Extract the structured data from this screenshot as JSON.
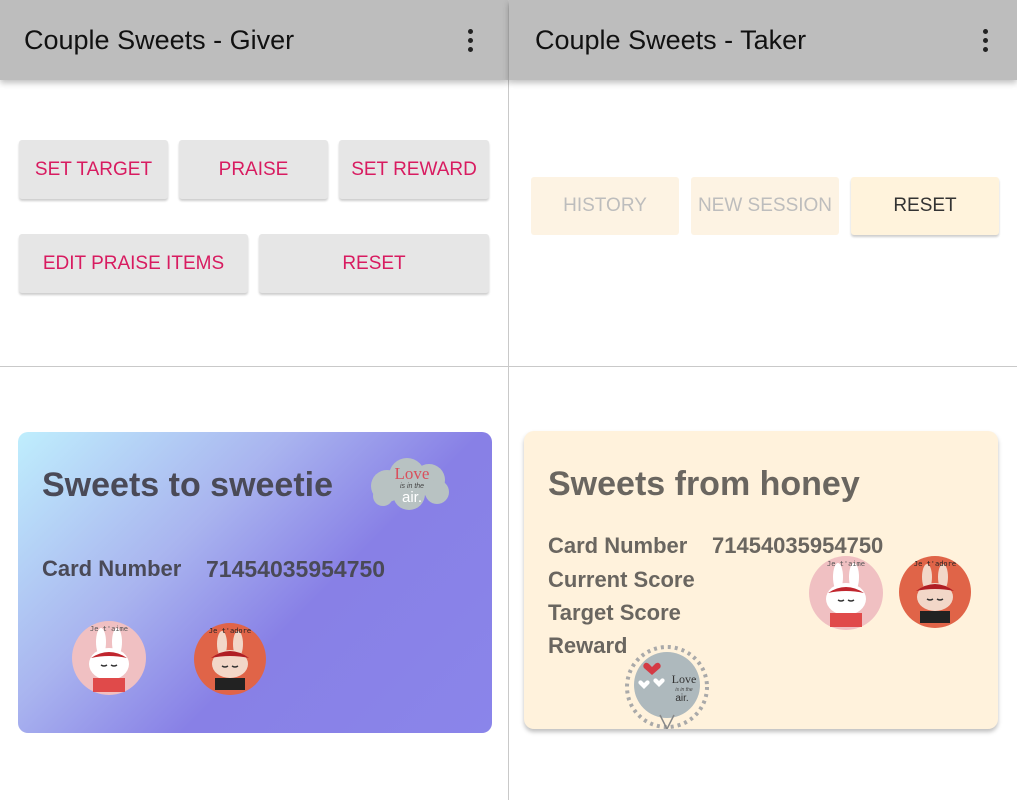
{
  "giver": {
    "appbar": {
      "title": "Couple Sweets - Giver",
      "overflow_icon": "more-vert-icon"
    },
    "buttons": {
      "set_target": "SET TARGET",
      "praise": "PRAISE",
      "set_reward": "SET REWARD",
      "edit_praise_items": "EDIT PRAISE ITEMS",
      "reset": "RESET"
    },
    "card": {
      "title": "Sweets to sweetie",
      "card_number_label": "Card Number",
      "card_number": "71454035954750",
      "sticker_love": {
        "word": "Love",
        "small": "is in the",
        "air": "air."
      },
      "sticker_1": "Je t'aime",
      "sticker_2": "Je t'adore"
    }
  },
  "taker": {
    "appbar": {
      "title": "Couple Sweets - Taker",
      "overflow_icon": "more-vert-icon"
    },
    "buttons": {
      "history": "HISTORY",
      "new_session": "NEW SESSION",
      "reset": "RESET"
    },
    "card": {
      "title": "Sweets from honey",
      "card_number_label": "Card Number",
      "card_number": "71454035954750",
      "current_score_label": "Current Score",
      "target_score_label": "Target Score",
      "reward_label": "Reward",
      "sticker_1": "Je t'aime",
      "sticker_2": "Je t'adore",
      "sticker_love": {
        "word": "Love",
        "small": "is in the",
        "air": "air."
      }
    }
  },
  "colors": {
    "accent": "#d81b60",
    "appbar": "#bdbdbd",
    "taker_card": "#fff2dc",
    "giver_card_start": "#bfeefd",
    "giver_card_end": "#8880e6"
  }
}
